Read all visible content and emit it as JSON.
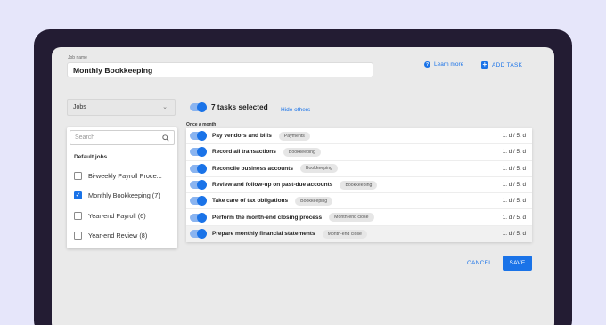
{
  "form": {
    "job_name_label": "Job name",
    "job_name_value": "Monthly Bookkeeping"
  },
  "header": {
    "learn_more": "Learn more",
    "add_task": "ADD TASK"
  },
  "jobs": {
    "select_value": "Jobs",
    "search_placeholder": "Search",
    "section_title": "Default jobs",
    "items": [
      {
        "label": "Bi-weekly Payroll Proce...",
        "checked": false
      },
      {
        "label": "Monthly Bookkeeping (7)",
        "checked": true
      },
      {
        "label": "Year-end Payroll (6)",
        "checked": false
      },
      {
        "label": "Year-end Review (8)",
        "checked": false
      }
    ]
  },
  "tasks": {
    "selected_text": "7 tasks selected",
    "hide_others": "Hide others",
    "frequency_label": "Once a month",
    "rows": [
      {
        "title": "Pay vendors and bills",
        "tag": "Payments",
        "days": "1. d / 5. d"
      },
      {
        "title": "Record all transactions",
        "tag": "Bookkeeping",
        "days": "1. d / 5. d"
      },
      {
        "title": "Reconcile business accounts",
        "tag": "Bookkeeping",
        "days": "1. d / 5. d"
      },
      {
        "title": "Review and follow-up on past-due accounts",
        "tag": "Bookkeeping",
        "days": "1. d / 5. d"
      },
      {
        "title": "Take care of tax obligations",
        "tag": "Bookkeeping",
        "days": "1. d / 5. d"
      },
      {
        "title": "Perform the month-end closing process",
        "tag": "Month-end close",
        "days": "1. d / 5. d"
      },
      {
        "title": "Prepare monthly financial statements",
        "tag": "Month-end close",
        "days": "1. d / 5. d"
      }
    ]
  },
  "footer": {
    "cancel": "CANCEL",
    "save": "SAVE"
  },
  "colors": {
    "accent": "#1a73e8",
    "background": "#e6e6fa",
    "device_frame": "#231c33"
  }
}
